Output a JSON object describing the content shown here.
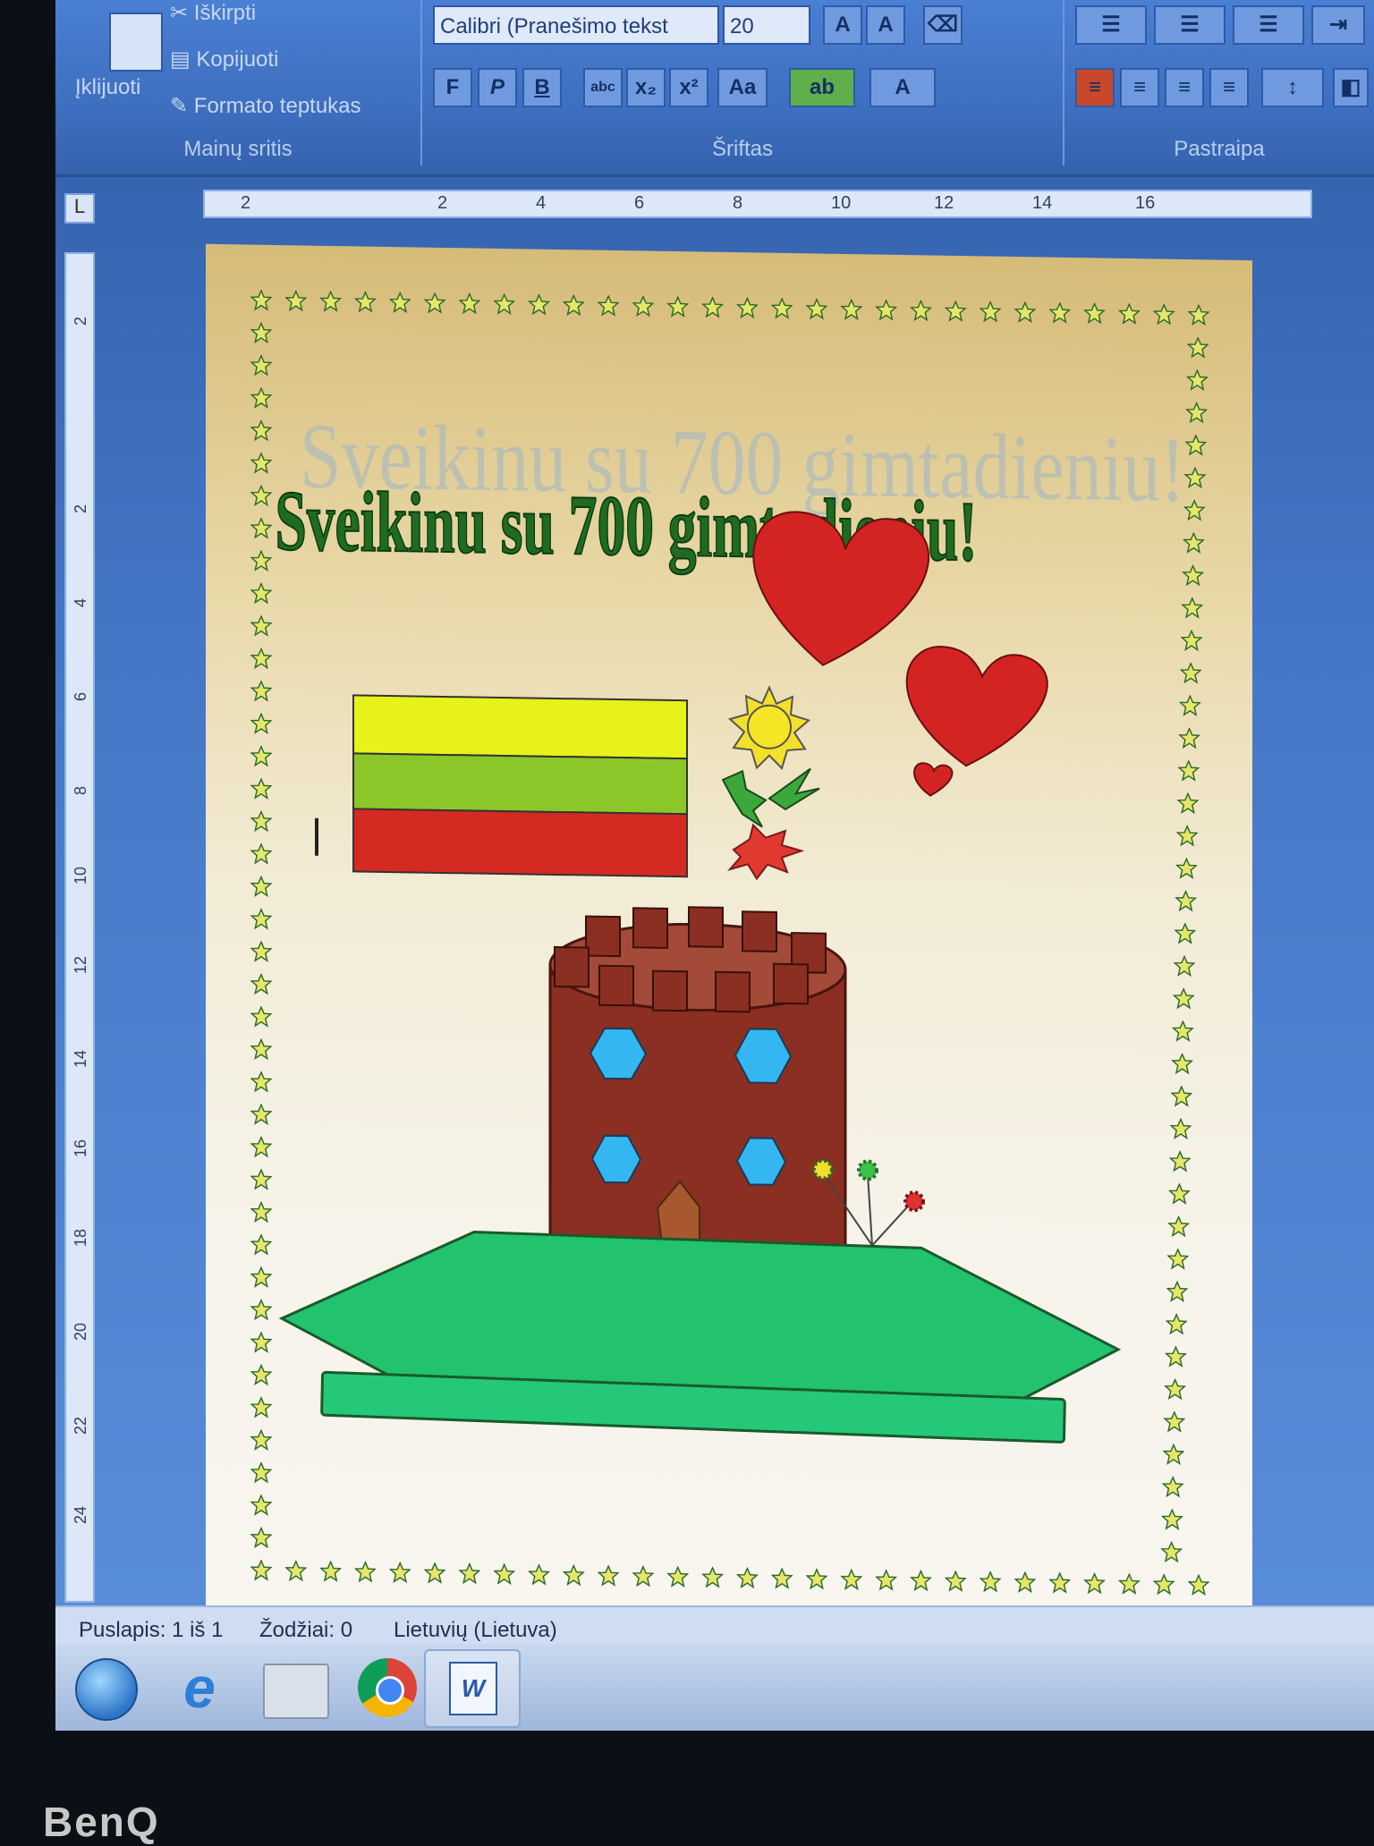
{
  "ribbon": {
    "clipboard": {
      "paste_label": "Įklijuoti",
      "cut_label": "Iškirpti",
      "copy_label": "Kopijuoti",
      "format_painter_label": "Formato teptukas",
      "group_label": "Mainų sritis"
    },
    "font": {
      "font_name": "Calibri (Pranešimo tekst",
      "font_size": "20",
      "group_label": "Šriftas",
      "bold": "F",
      "italic": "P",
      "underline": "B",
      "strike": "abc",
      "subscript": "x₂",
      "superscript": "x²",
      "change_case": "Aa"
    },
    "paragraph": {
      "group_label": "Pastraipa"
    }
  },
  "ruler": {
    "marks": [
      "2",
      "2",
      "4",
      "6",
      "8",
      "10",
      "12",
      "14",
      "16"
    ]
  },
  "vruler": {
    "marks": [
      "2",
      "2",
      "4",
      "6",
      "8",
      "10",
      "12",
      "14",
      "16",
      "18",
      "20",
      "22",
      "24"
    ]
  },
  "document": {
    "heading": "Sveikinu su 700 gimtadieniu!",
    "heading_shadow": "Sveikinu su 700 gimtadieniu!",
    "flag_colors": [
      "#e6f21a",
      "#8cc72a",
      "#d42a22"
    ],
    "accent_colors": {
      "heart": "#d42323",
      "tower": "#8a2f22",
      "hill": "#22c26e",
      "window": "#34b7f0",
      "star_border": "#dede5a"
    }
  },
  "status_bar": {
    "page": "Puslapis: 1 iš 1",
    "words": "Žodžiai: 0",
    "language": "Lietuvių (Lietuva)"
  },
  "taskbar": {
    "icons": [
      "start-orb-icon",
      "internet-explorer-icon",
      "printer-folder-icon",
      "chrome-icon",
      "word-icon"
    ]
  },
  "bezel": {
    "brand": "BenQ"
  }
}
